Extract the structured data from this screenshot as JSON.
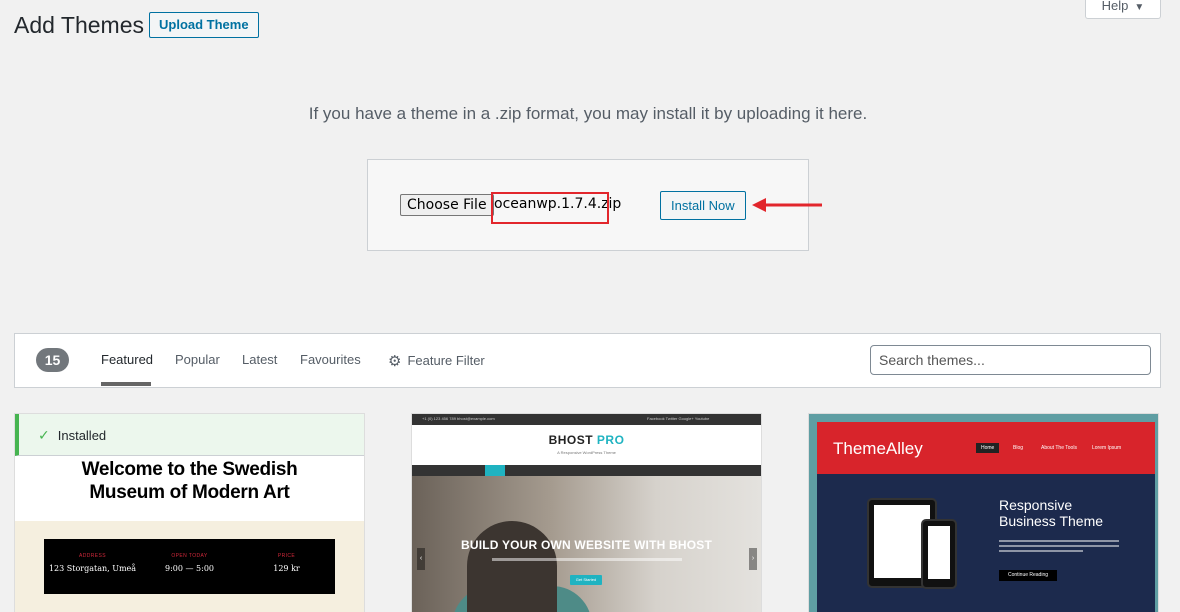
{
  "header": {
    "title": "Add Themes",
    "upload_label": "Upload Theme",
    "help_label": "Help",
    "help_caret": "▼"
  },
  "upload": {
    "description": "If you have a theme in a .zip format, you may install it by uploading it here.",
    "choose_file_label": "Choose File",
    "file_name": "oceanwp.1.7.4.zip",
    "install_label": "Install Now",
    "highlight_color": "#e2262c"
  },
  "filter": {
    "count": "15",
    "tabs": [
      {
        "label": "Featured",
        "active": true
      },
      {
        "label": "Popular",
        "active": false
      },
      {
        "label": "Latest",
        "active": false
      },
      {
        "label": "Favourites",
        "active": false
      }
    ],
    "feature_filter_label": "Feature Filter",
    "search_placeholder": "Search themes..."
  },
  "themes": [
    {
      "installed_label": "Installed",
      "headline_line1": "Welcome to the Swedish",
      "headline_line2": "Museum of Modern Art",
      "info": [
        {
          "label": "ADDRESS",
          "value": "123 Storgatan, Umeå"
        },
        {
          "label": "OPEN TODAY",
          "value": "9:00 — 5:00"
        },
        {
          "label": "PRICE",
          "value": "129 kr"
        }
      ]
    },
    {
      "logo_main": "BHOST",
      "logo_pro": "PRO",
      "tagline": "A Responsive WordPress Theme",
      "hero_title": "BUILD YOUR OWN WEBSITE WITH BHOST",
      "hero_button": "Get Started",
      "top_left": "+1 (0) 123 456 789   bhost@example.com",
      "top_right": "Facebook   Twitter   Google+   Youtube"
    },
    {
      "logo": "ThemeAlley",
      "nav": [
        "Home",
        "Blog",
        "About The Tools",
        "Lorem Ipsum"
      ],
      "headline_line1": "Responsive",
      "headline_line2": "Business Theme",
      "button": "Continue Reading"
    }
  ],
  "colors": {
    "accent": "#0071a1",
    "installed_green": "#46b450",
    "bhost_teal": "#1fb3c1",
    "themealley_red": "#d8242b"
  }
}
